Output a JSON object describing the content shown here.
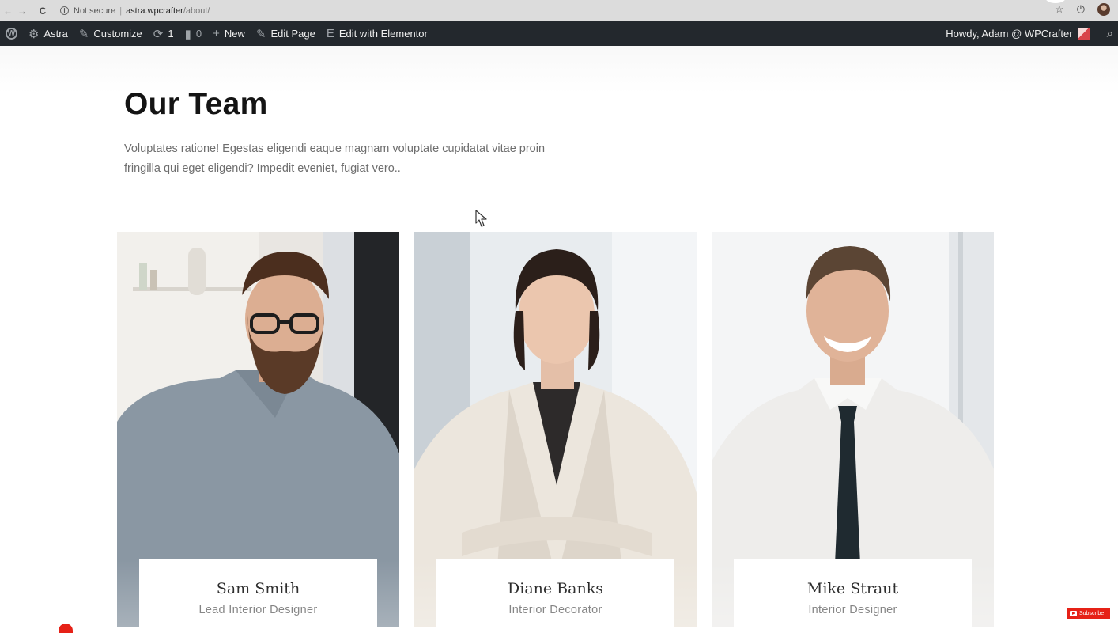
{
  "browser": {
    "back_icon": "←",
    "forward_icon": "→",
    "reload_icon": "C",
    "security_label": "Not secure",
    "url_host": "astra.wpcrafter",
    "url_path": "/about/",
    "star_icon": "☆",
    "power_icon": "⏻"
  },
  "admin_bar": {
    "wp_logo": "W",
    "site_icon": "⚙",
    "site_name": "Astra",
    "customize_icon": "✎",
    "customize_label": "Customize",
    "updates_icon": "⟳",
    "updates_count": "1",
    "comments_icon": "▮",
    "comments_count": "0",
    "new_icon": "+",
    "new_label": "New",
    "edit_icon": "✎",
    "edit_label": "Edit Page",
    "elementor_icon": "E",
    "elementor_label": "Edit with Elementor",
    "greeting": "Howdy, Adam @ WPCrafter",
    "search_icon": "⌕"
  },
  "content": {
    "title": "Our Team",
    "description": "Voluptates ratione! Egestas eligendi eaque magnam voluptate cupidatat vitae proin fringilla qui eget eligendi? Impedit eveniet, fugiat vero.."
  },
  "team": [
    {
      "name": "Sam Smith",
      "role": "Lead Interior Designer"
    },
    {
      "name": "Diane Banks",
      "role": "Interior Decorator"
    },
    {
      "name": "Mike Straut",
      "role": "Interior Designer"
    }
  ],
  "overlay": {
    "subscribe_label": "Subscribe"
  },
  "colors": {
    "admin_bar": "#23282d",
    "title": "#141414",
    "body_text": "#6e6e6e",
    "youtube_red": "#e62117"
  }
}
